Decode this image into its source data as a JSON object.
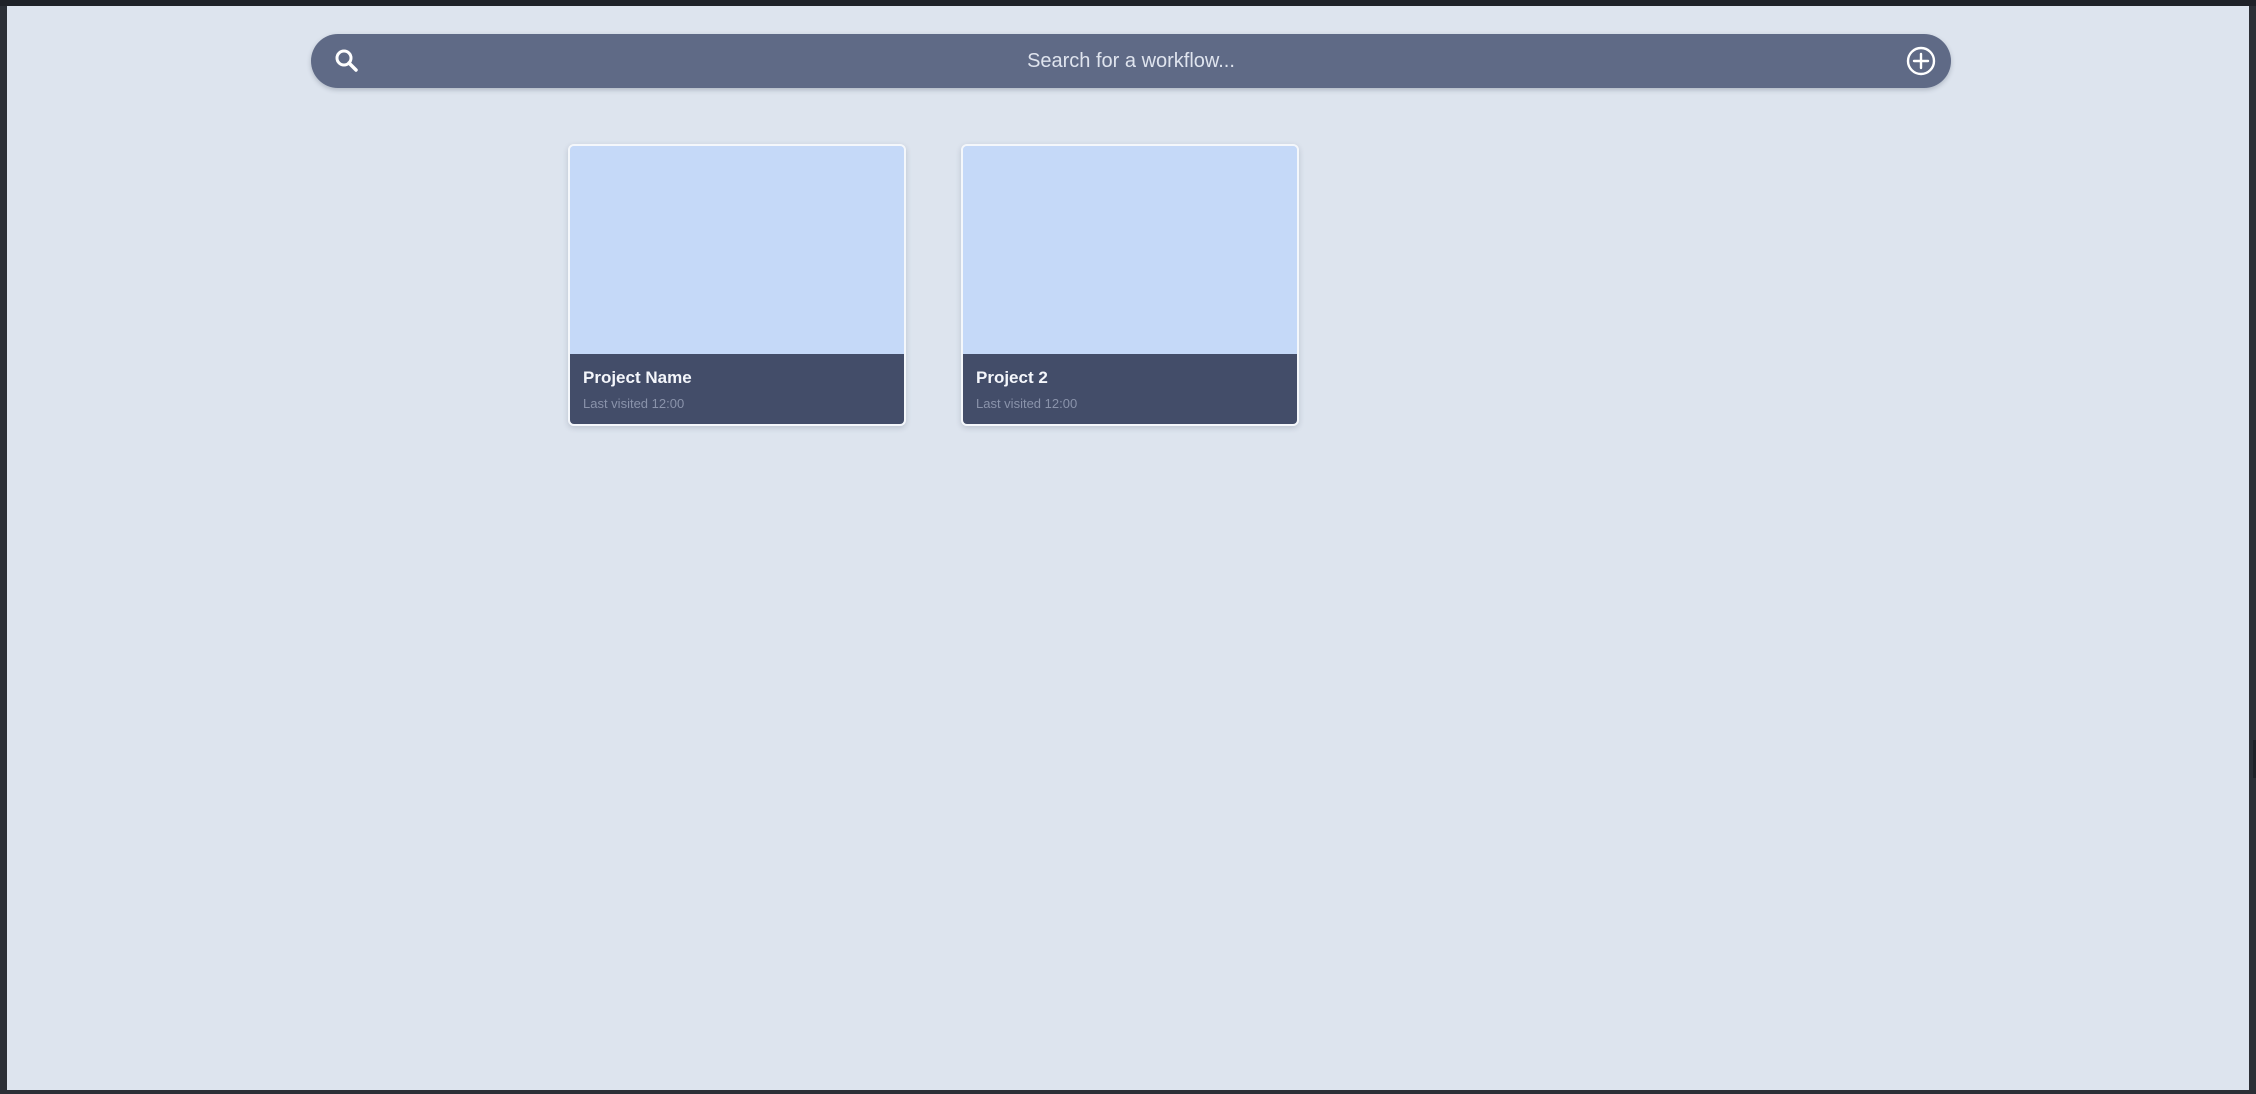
{
  "search": {
    "placeholder": "Search for a workflow...",
    "icon": "search-icon",
    "add_icon": "plus-circle-icon"
  },
  "projects": [
    {
      "name": "Project Name",
      "last_visited": "Last visited 12:00"
    },
    {
      "name": "Project 2",
      "last_visited": "Last visited 12:00"
    }
  ],
  "colors": {
    "background": "#dde4ee",
    "search_bar": "#5f6a86",
    "card_thumbnail": "#c5d9f8",
    "card_footer": "#434d69"
  }
}
